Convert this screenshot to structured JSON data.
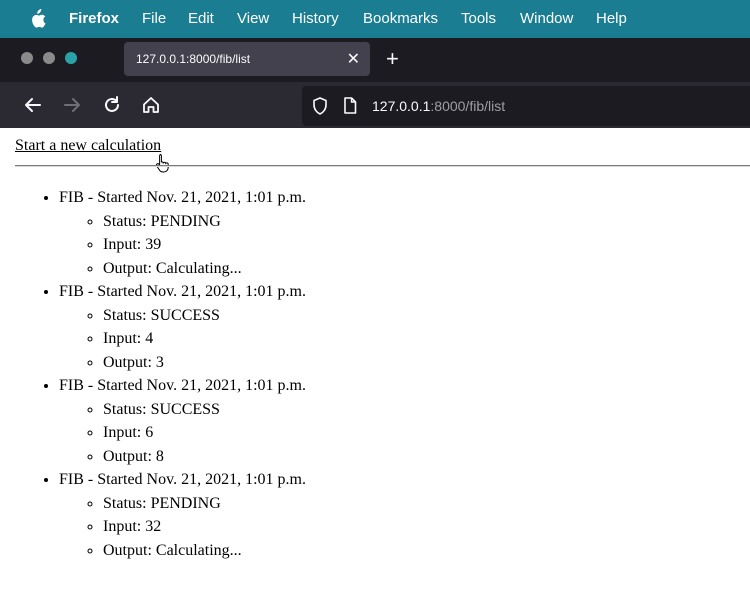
{
  "menubar": {
    "app": "Firefox",
    "items": [
      "File",
      "Edit",
      "View",
      "History",
      "Bookmarks",
      "Tools",
      "Window",
      "Help"
    ]
  },
  "browser": {
    "tab_title": "127.0.0.1:8000/fib/list",
    "url_host": "127.0.0.1",
    "url_rest": ":8000/fib/list"
  },
  "page": {
    "new_calc_link": "Start a new calculation",
    "tasks": [
      {
        "title": "FIB - Started Nov. 21, 2021, 1:01 p.m.",
        "status": "Status: PENDING",
        "input": "Input: 39",
        "output": "Output: Calculating..."
      },
      {
        "title": "FIB - Started Nov. 21, 2021, 1:01 p.m.",
        "status": "Status: SUCCESS",
        "input": "Input: 4",
        "output": "Output: 3"
      },
      {
        "title": "FIB - Started Nov. 21, 2021, 1:01 p.m.",
        "status": "Status: SUCCESS",
        "input": "Input: 6",
        "output": "Output: 8"
      },
      {
        "title": "FIB - Started Nov. 21, 2021, 1:01 p.m.",
        "status": "Status: PENDING",
        "input": "Input: 32",
        "output": "Output: Calculating..."
      }
    ]
  },
  "icons": {
    "apple": "apple-logo-icon",
    "close": "close-icon",
    "new_tab": "plus-icon",
    "back": "back-arrow-icon",
    "forward": "forward-arrow-icon",
    "reload": "reload-icon",
    "home": "home-icon",
    "shield": "shield-icon",
    "page": "page-icon",
    "cursor": "hand-pointer-icon"
  },
  "colors": {
    "menubar_bg": "#1a7d91",
    "tabstrip_bg": "#1c1b22",
    "tab_active_bg": "#42414d",
    "toolbar_bg": "#2b2a33",
    "urlbar_bg": "#1c1b22",
    "page_bg": "#ffffff"
  }
}
